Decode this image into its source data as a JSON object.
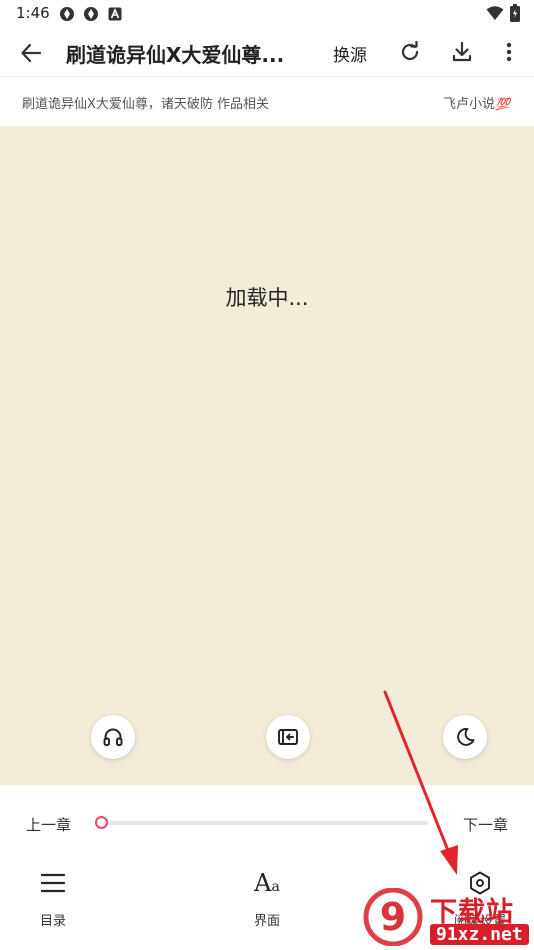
{
  "status_bar": {
    "time": "1:46",
    "left_icons": [
      "settings-sync-icon",
      "settings-sync-icon",
      "app-a-icon"
    ],
    "right_icons": [
      "wifi-icon",
      "battery-icon"
    ]
  },
  "toolbar": {
    "title": "刷道诡异仙X大爱仙尊...",
    "switch_source_label": "换源",
    "icons": [
      "back-arrow-icon",
      "refresh-icon",
      "download-icon",
      "more-vert-icon"
    ]
  },
  "info_bar": {
    "book_info": "刷道诡异仙X大爱仙尊，诸天破防 作品相关",
    "source_name": "飞卢小说",
    "source_emoji": "💯"
  },
  "content": {
    "loading_text": "加载中...",
    "background_color": "#f3ecd9"
  },
  "fabs": [
    "headphones-icon",
    "exit-read-icon",
    "moon-icon"
  ],
  "bottom_panel": {
    "prev_chapter": "上一章",
    "next_chapter": "下一章",
    "progress_fraction": 0,
    "accent_color": "#e84a5f",
    "nav": [
      {
        "label": "目录",
        "icon": "menu-list-icon"
      },
      {
        "label": "界面",
        "icon": "font-aa-icon",
        "glyph_big": "A",
        "glyph_small": "a"
      },
      {
        "label": "阅读设置",
        "icon": "hexagon-settings-icon"
      }
    ]
  },
  "annotation": {
    "arrow_color": "#e0262b"
  },
  "watermark": {
    "logo_text": "9",
    "top_text": "下载站",
    "bottom_text": "91xz.net",
    "color": "#d81e28"
  }
}
